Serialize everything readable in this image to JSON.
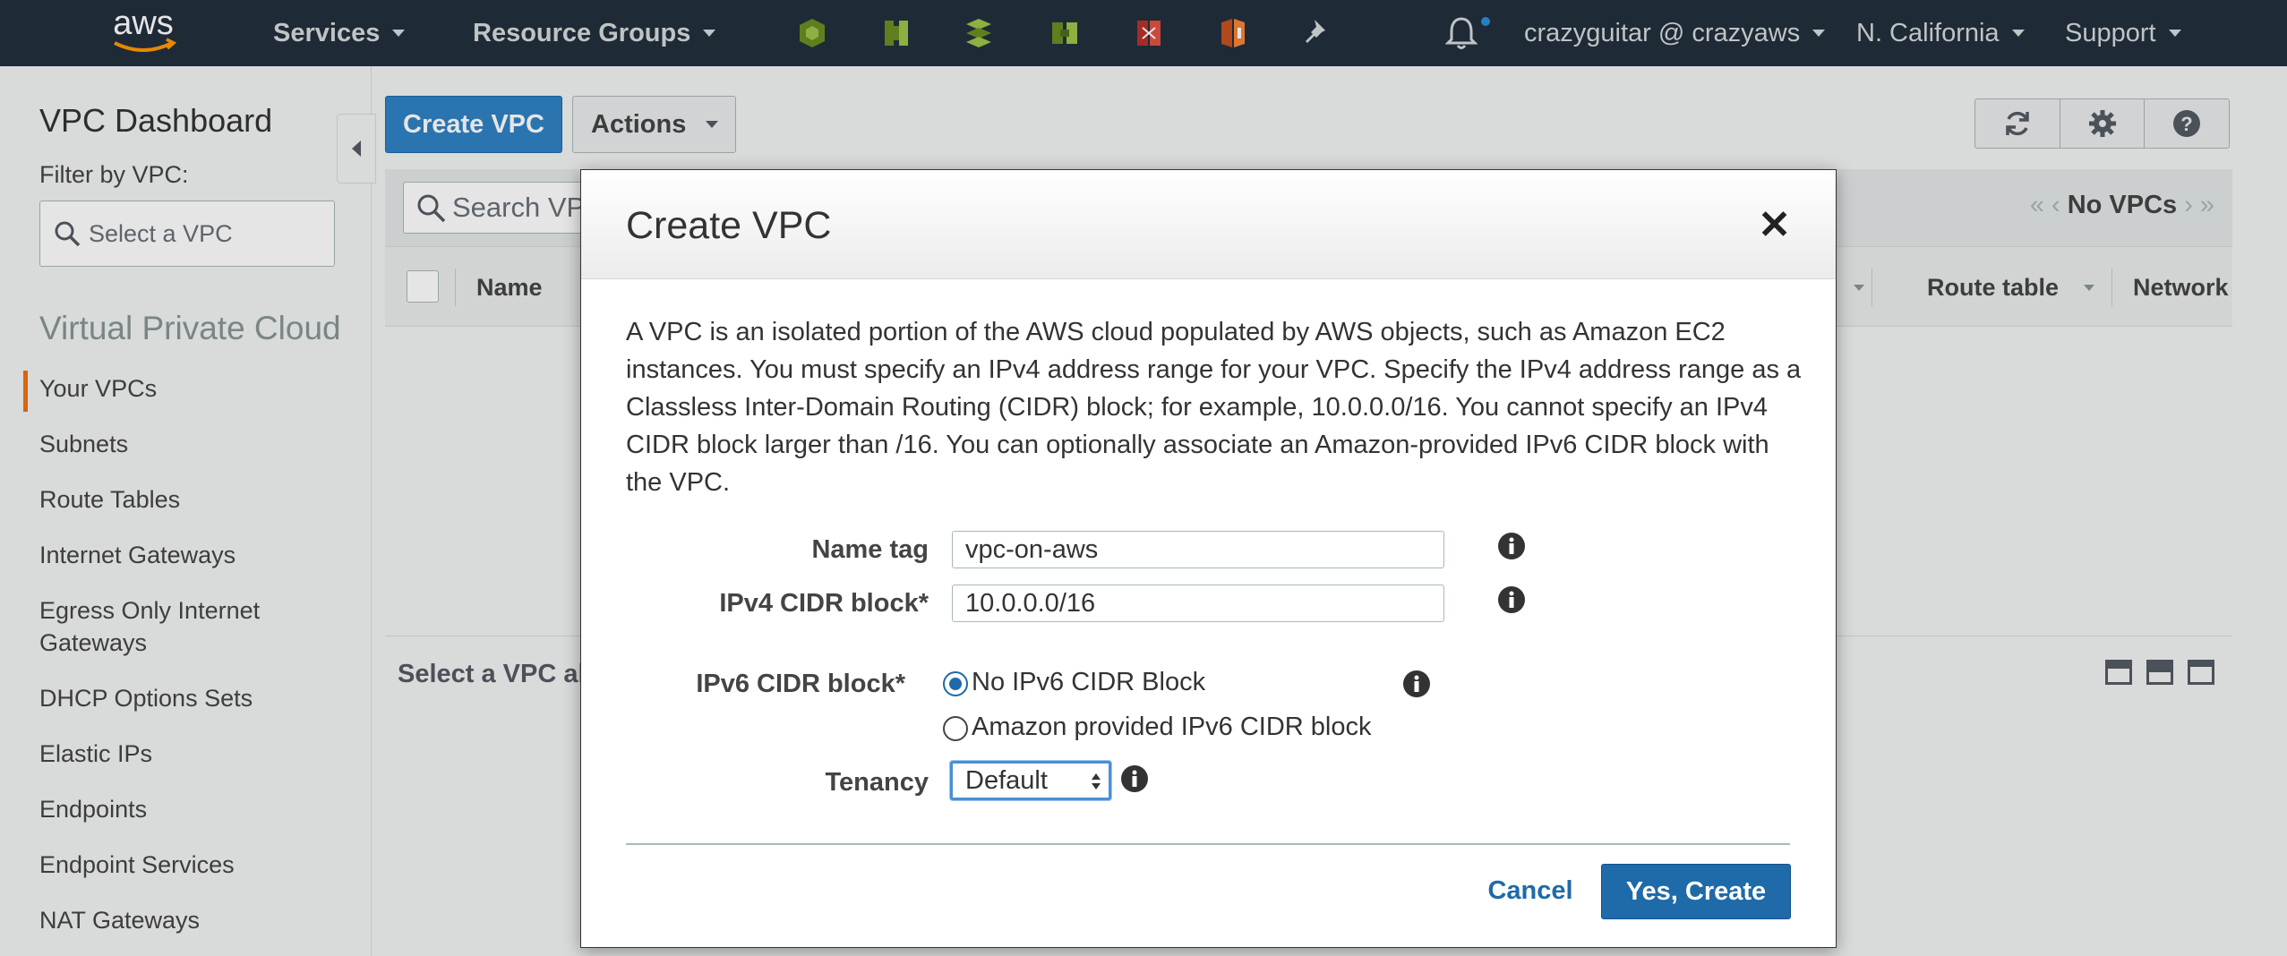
{
  "topnav": {
    "services": "Services",
    "resource_groups": "Resource Groups",
    "account": "crazyguitar @ crazyaws",
    "region": "N. California",
    "support": "Support",
    "shortcut_icons": [
      "green-service-icon",
      "green-service-icon",
      "green-service-icon",
      "green-service-icon",
      "red-service-icon",
      "orange-service-icon"
    ],
    "pin_icon": "pin-icon",
    "bell_icon": "bell-icon"
  },
  "sidebar": {
    "title": "VPC Dashboard",
    "filter_label": "Filter by VPC:",
    "vpc_select_placeholder": "Select a VPC",
    "section_title": "Virtual Private Cloud",
    "items": [
      {
        "label": "Your VPCs",
        "active": true
      },
      {
        "label": "Subnets"
      },
      {
        "label": "Route Tables"
      },
      {
        "label": "Internet Gateways"
      },
      {
        "label": "Egress Only Internet Gateways"
      },
      {
        "label": "DHCP Options Sets"
      },
      {
        "label": "Elastic IPs"
      },
      {
        "label": "Endpoints"
      },
      {
        "label": "Endpoint Services"
      },
      {
        "label": "NAT Gateways"
      }
    ]
  },
  "main": {
    "create_button": "Create VPC",
    "actions_button": "Actions",
    "search_placeholder": "Search VPCs",
    "pager_text": "No VPCs",
    "columns": [
      "Name",
      "Route table",
      "Network ACL"
    ],
    "detail_text": "Select a VPC above"
  },
  "modal": {
    "title": "Create VPC",
    "description": "A VPC is an isolated portion of the AWS cloud populated by AWS objects, such as Amazon EC2 instances. You must specify an IPv4 address range for your VPC. Specify the IPv4 address range as a Classless Inter-Domain Routing (CIDR) block; for example, 10.0.0.0/16. You cannot specify an IPv4 CIDR block larger than /16. You can optionally associate an Amazon-provided IPv6 CIDR block with the VPC.",
    "name_tag_label": "Name tag",
    "name_tag_value": "vpc-on-aws",
    "ipv4_label": "IPv4 CIDR block*",
    "ipv4_value": "10.0.0.0/16",
    "ipv6_label": "IPv6 CIDR block*",
    "ipv6_options": [
      "No IPv6 CIDR Block",
      "Amazon provided IPv6 CIDR block"
    ],
    "ipv6_selected": "No IPv6 CIDR Block",
    "tenancy_label": "Tenancy",
    "tenancy_value": "Default",
    "cancel_button": "Cancel",
    "create_button": "Yes, Create"
  },
  "colors": {
    "nav_bg": "#232f3e",
    "primary": "#1f6aa8",
    "active_accent": "#ec7211"
  }
}
